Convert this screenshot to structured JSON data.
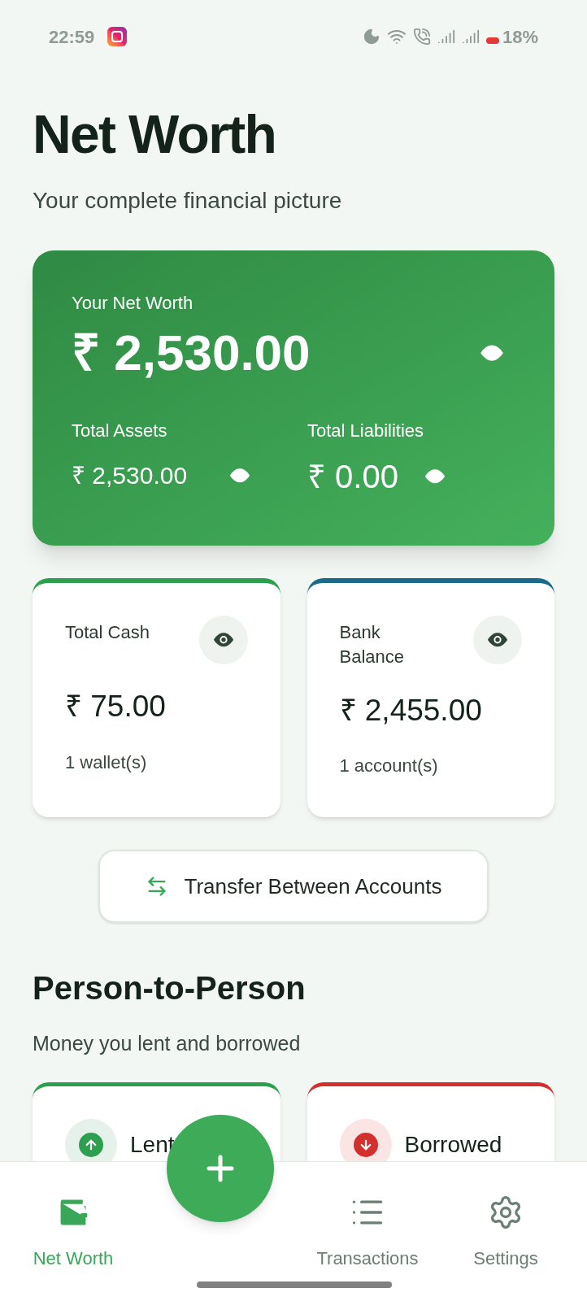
{
  "status_bar": {
    "time": "22:59",
    "battery": "18%"
  },
  "header": {
    "title": "Net Worth",
    "subtitle": "Your complete financial picture"
  },
  "net_worth_card": {
    "label": "Your Net Worth",
    "amount": "₹ 2,530.00",
    "assets_label": "Total Assets",
    "assets": "₹ 2,530.00",
    "liabilities_label": "Total Liabilities",
    "liabilities": "₹ 0.00"
  },
  "balance_cards": [
    {
      "label": "Total Cash",
      "amount": "₹ 75.00",
      "count": "1 wallet(s)",
      "color": "#2e9e4f"
    },
    {
      "label": "Bank Balance",
      "amount": "₹ 2,455.00",
      "count": "1 account(s)",
      "color": "#1b6a8a"
    }
  ],
  "transfer_button": "Transfer Between Accounts",
  "p2p": {
    "title": "Person-to-Person",
    "subtitle": "Money you lent and borrowed",
    "cards": [
      {
        "kind": "lent",
        "label": "Lent",
        "color": "#2e9e4f"
      },
      {
        "kind": "borrowed",
        "label": "Borrowed",
        "color": "#d32f2f"
      }
    ]
  },
  "bottom_nav": [
    {
      "kind": "wallet",
      "label": "Net Worth",
      "selected": true
    },
    {
      "kind": "list",
      "label": "Transactions",
      "selected": false
    },
    {
      "kind": "gear",
      "label": "Settings",
      "selected": false
    }
  ]
}
